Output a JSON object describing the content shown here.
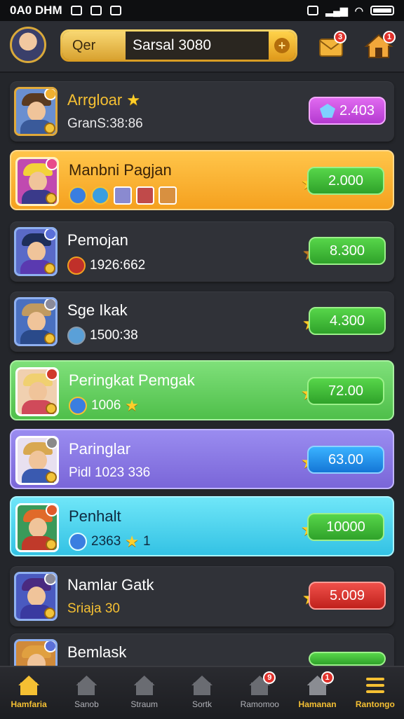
{
  "status_bar": {
    "time": "0A0 DHM"
  },
  "header": {
    "search": {
      "label": "Qer",
      "value": "Sarsal 3080"
    },
    "mail_badge": "3",
    "home_badge": "1"
  },
  "rows": [
    {
      "name": "Arrgloar",
      "sub": "GranS:38:86",
      "pill": "2.403",
      "pill_style": "purple",
      "theme": "dark"
    },
    {
      "name": "Manbni Pagjan",
      "sub": "",
      "pill": "2.000",
      "pill_style": "green",
      "theme": "orange"
    },
    {
      "name": "Pemojan",
      "sub": "1926:662",
      "pill": "8.300",
      "pill_style": "green",
      "theme": "dark"
    },
    {
      "name": "Sge Ikak",
      "sub": "1500:38",
      "pill": "4.300",
      "pill_style": "green",
      "theme": "dark"
    },
    {
      "name": "Peringkat Pemgak",
      "sub": "1006",
      "pill": "72.00",
      "pill_style": "green",
      "theme": "green"
    },
    {
      "name": "Paringlar",
      "sub": "Pidl 1023 336",
      "pill": "63.00",
      "pill_style": "blue",
      "theme": "purple"
    },
    {
      "name": "Penhalt",
      "sub": "2363",
      "pill": "10000",
      "pill_style": "green",
      "theme": "cyan"
    },
    {
      "name": "Namlar Gatk",
      "sub": "Sriaja 30",
      "pill": "5.009",
      "pill_style": "red",
      "theme": "dark"
    },
    {
      "name": "Bemlask",
      "sub": "",
      "pill": "",
      "pill_style": "green",
      "theme": "dark"
    }
  ],
  "row3_extra": "1",
  "tabs": [
    {
      "label": "Hamfaria",
      "icon": "home-icon"
    },
    {
      "label": "Sanob",
      "icon": "house-icon"
    },
    {
      "label": "Straum",
      "icon": "house-icon"
    },
    {
      "label": "Sortk",
      "icon": "house-icon"
    },
    {
      "label": "Ramomoo",
      "icon": "house-icon",
      "badge": "9"
    },
    {
      "label": "Hamanan",
      "icon": "house-icon",
      "badge": "1"
    },
    {
      "label": "Rantongo",
      "icon": "menu-icon"
    }
  ],
  "colors": {
    "gold": "#f5c033",
    "bg": "#24262b"
  }
}
